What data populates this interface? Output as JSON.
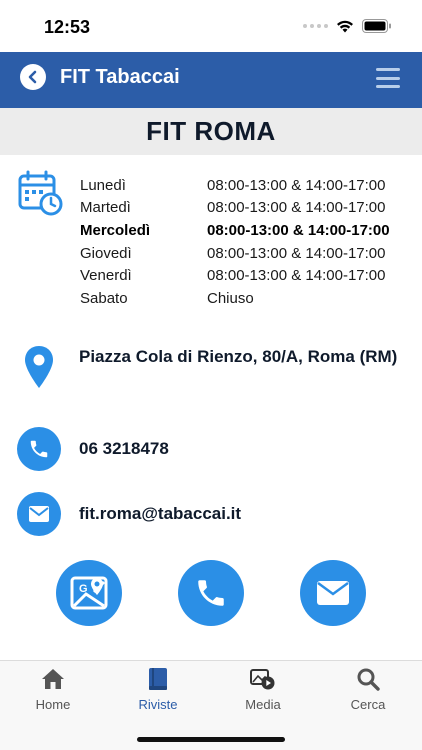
{
  "status_bar": {
    "time": "12:53"
  },
  "nav": {
    "title": "FIT Tabaccai"
  },
  "store": {
    "name": "FIT ROMA"
  },
  "hours": [
    {
      "day": "Lunedì",
      "time": "08:00-13:00 & 14:00-17:00",
      "today": false
    },
    {
      "day": "Martedì",
      "time": "08:00-13:00 & 14:00-17:00",
      "today": false
    },
    {
      "day": "Mercoledì",
      "time": "08:00-13:00 & 14:00-17:00",
      "today": true
    },
    {
      "day": "Giovedì",
      "time": "08:00-13:00 & 14:00-17:00",
      "today": false
    },
    {
      "day": "Venerdì",
      "time": "08:00-13:00 & 14:00-17:00",
      "today": false
    },
    {
      "day": "Sabato",
      "time": "Chiuso",
      "today": false
    }
  ],
  "contact": {
    "address": "Piazza Cola di Rienzo, 80/A, Roma (RM)",
    "phone": "06 3218478",
    "email": "fit.roma@tabaccai.it"
  },
  "tabs": [
    {
      "label": "Home",
      "icon": "home-icon",
      "active": false
    },
    {
      "label": "Riviste",
      "icon": "book-icon",
      "active": true
    },
    {
      "label": "Media",
      "icon": "media-icon",
      "active": false
    },
    {
      "label": "Cerca",
      "icon": "search-icon",
      "active": false
    }
  ],
  "colors": {
    "nav_blue": "#2c5da8",
    "accent_blue": "#2b8fe6",
    "header_gray": "#ececec"
  }
}
